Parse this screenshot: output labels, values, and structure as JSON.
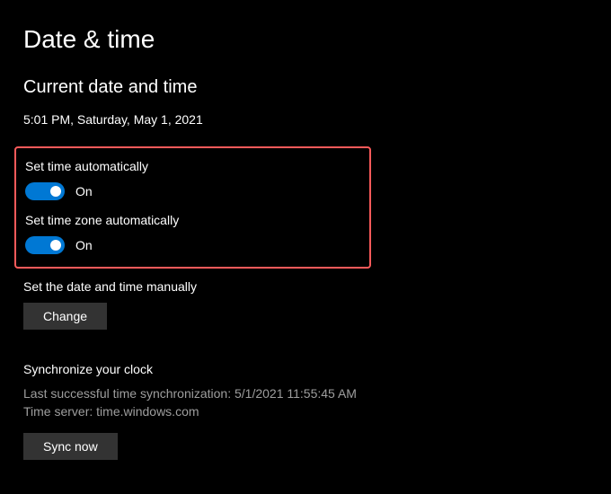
{
  "page": {
    "title": "Date & time"
  },
  "current": {
    "heading": "Current date and time",
    "datetime": "5:01 PM, Saturday, May 1, 2021"
  },
  "settings": {
    "auto_time": {
      "label": "Set time automatically",
      "state": "On"
    },
    "auto_timezone": {
      "label": "Set time zone automatically",
      "state": "On"
    },
    "manual": {
      "label": "Set the date and time manually",
      "button": "Change"
    }
  },
  "sync": {
    "heading": "Synchronize your clock",
    "last_sync": "Last successful time synchronization: 5/1/2021 11:55:45 AM",
    "server": "Time server: time.windows.com",
    "button": "Sync now"
  },
  "colors": {
    "accent": "#0078d4",
    "highlight_border": "#ff5a5a"
  }
}
